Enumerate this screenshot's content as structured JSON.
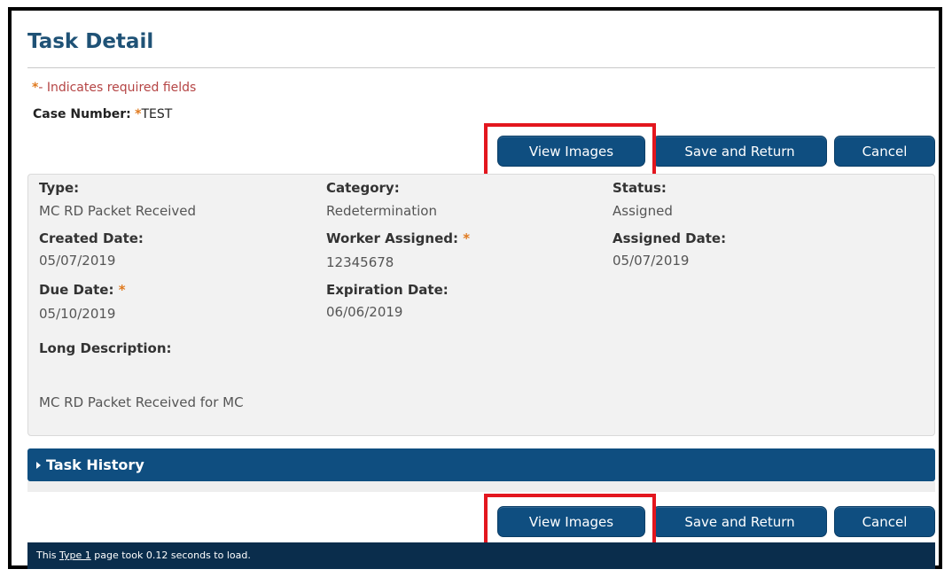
{
  "page": {
    "title": "Task Detail",
    "required_note_star": "*",
    "required_note_text": "- Indicates required fields",
    "case_number_label": "Case Number:",
    "case_number_star": "*",
    "case_number_value": "TEST"
  },
  "actions": {
    "view_images": "View Images",
    "save_return": "Save and Return",
    "cancel": "Cancel"
  },
  "details": {
    "type_label": "Type:",
    "type_value": "MC RD Packet Received",
    "category_label": "Category:",
    "category_value": "Redetermination",
    "status_label": "Status:",
    "status_value": "Assigned",
    "created_label": "Created Date:",
    "created_value": "05/07/2019",
    "worker_label": "Worker Assigned:",
    "worker_star": "*",
    "worker_value": "12345678",
    "assigned_label": "Assigned Date:",
    "assigned_value": "05/07/2019",
    "due_label": "Due Date:",
    "due_star": "*",
    "due_value": "05/10/2019",
    "expiration_label": "Expiration Date:",
    "expiration_value": "06/06/2019",
    "long_desc_label": "Long Description:",
    "long_desc_value": "MC RD Packet Received for MC"
  },
  "history": {
    "label": "Task History"
  },
  "footer": {
    "prefix": "This ",
    "link": "Type 1",
    "suffix": " page took 0.12 seconds to load."
  },
  "colors": {
    "accent": "#0f4e80",
    "title": "#1f5276",
    "required_star": "#e07a1f",
    "highlight": "#e3161e",
    "footer": "#0a2d4c"
  }
}
